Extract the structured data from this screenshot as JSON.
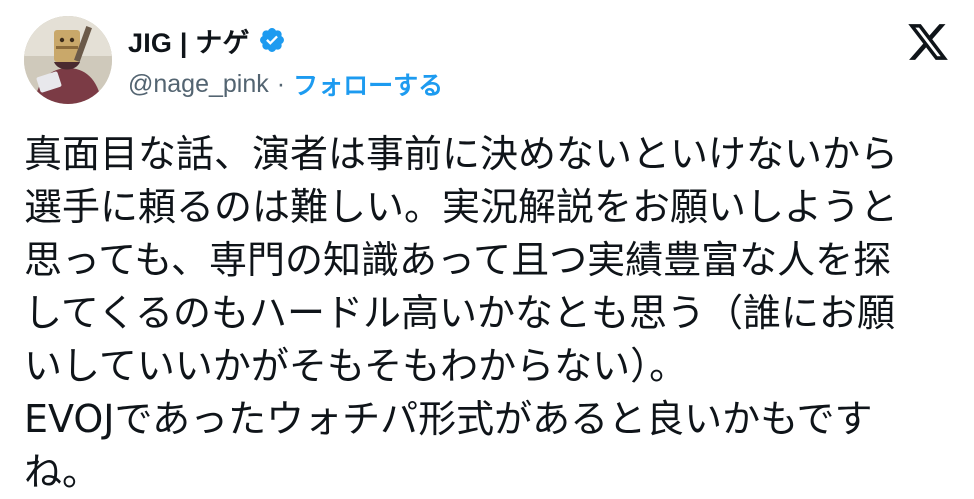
{
  "tweet": {
    "author": {
      "display_name": "JIG | ナゲ",
      "handle": "@nage_pink",
      "separator": "·",
      "follow_label": "フォローする",
      "verified": true,
      "avatar_icon": "avatar-image"
    },
    "platform_icon": "x-logo-icon",
    "text_lines": [
      "真面目な話、演者は事前に決めないといけないから",
      "選手に頼るのは難しい。実況解説をお願いしようと",
      "思っても、専門の知識あって且つ実績豊富な人を探",
      "してくるのもハードル高いかなとも思う（誰にお願",
      "いしていいかがそもそもわからない）。",
      "EVOJであったウォチパ形式があると良いかもです",
      "ね。"
    ]
  },
  "colors": {
    "text": "#0f1419",
    "secondary": "#536471",
    "accent": "#1d9bf0"
  }
}
